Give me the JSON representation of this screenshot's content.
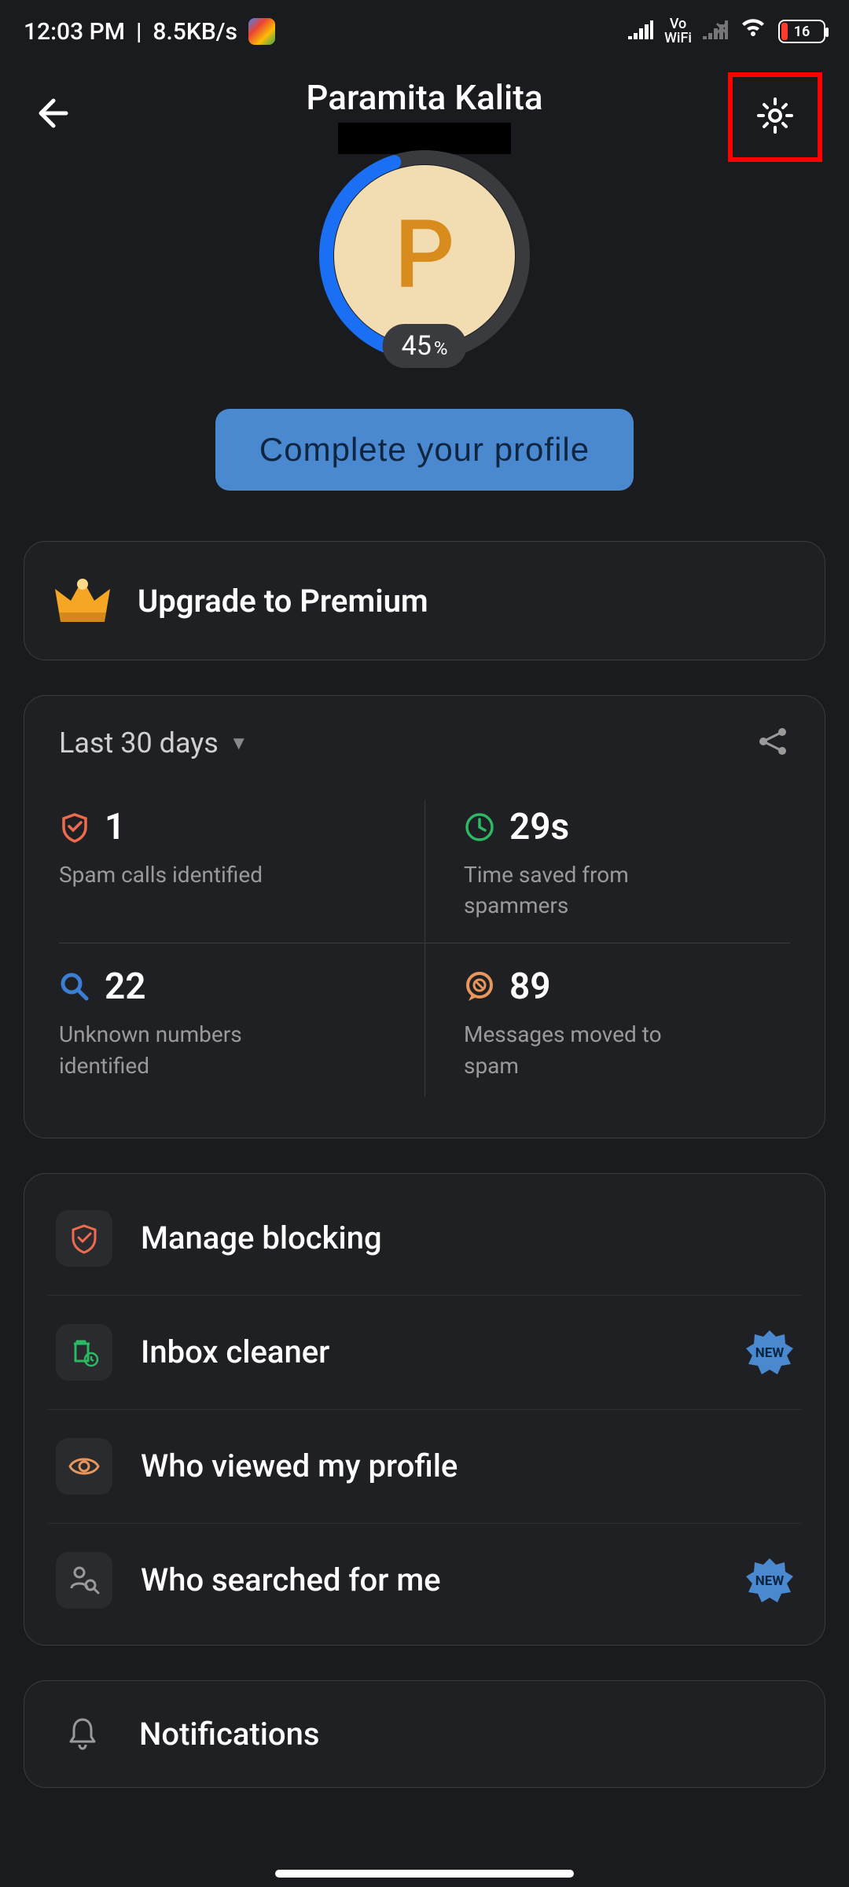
{
  "status_bar": {
    "time": "12:03 PM",
    "separator": "|",
    "data_rate": "8.5KB/s",
    "vowifi_top": "Vo",
    "vowifi_bottom": "WiFi",
    "battery_percent": "16"
  },
  "header": {
    "profile_name": "Paramita Kalita"
  },
  "avatar": {
    "initial": "P",
    "progress_value": "45",
    "progress_suffix": "%"
  },
  "cta": {
    "complete_profile": "Complete your profile"
  },
  "premium": {
    "label": "Upgrade to Premium"
  },
  "stats": {
    "period_label": "Last 30 days",
    "cells": [
      {
        "value": "1",
        "label": "Spam calls identified"
      },
      {
        "value": "29s",
        "label": "Time saved from spammers"
      },
      {
        "value": "22",
        "label": "Unknown numbers identified"
      },
      {
        "value": "89",
        "label": "Messages moved to spam"
      }
    ]
  },
  "menu": {
    "items": [
      {
        "label": "Manage blocking",
        "badge": ""
      },
      {
        "label": "Inbox cleaner",
        "badge": "NEW"
      },
      {
        "label": "Who viewed my profile",
        "badge": ""
      },
      {
        "label": "Who searched for me",
        "badge": "NEW"
      }
    ]
  },
  "notifications": {
    "label": "Notifications"
  }
}
